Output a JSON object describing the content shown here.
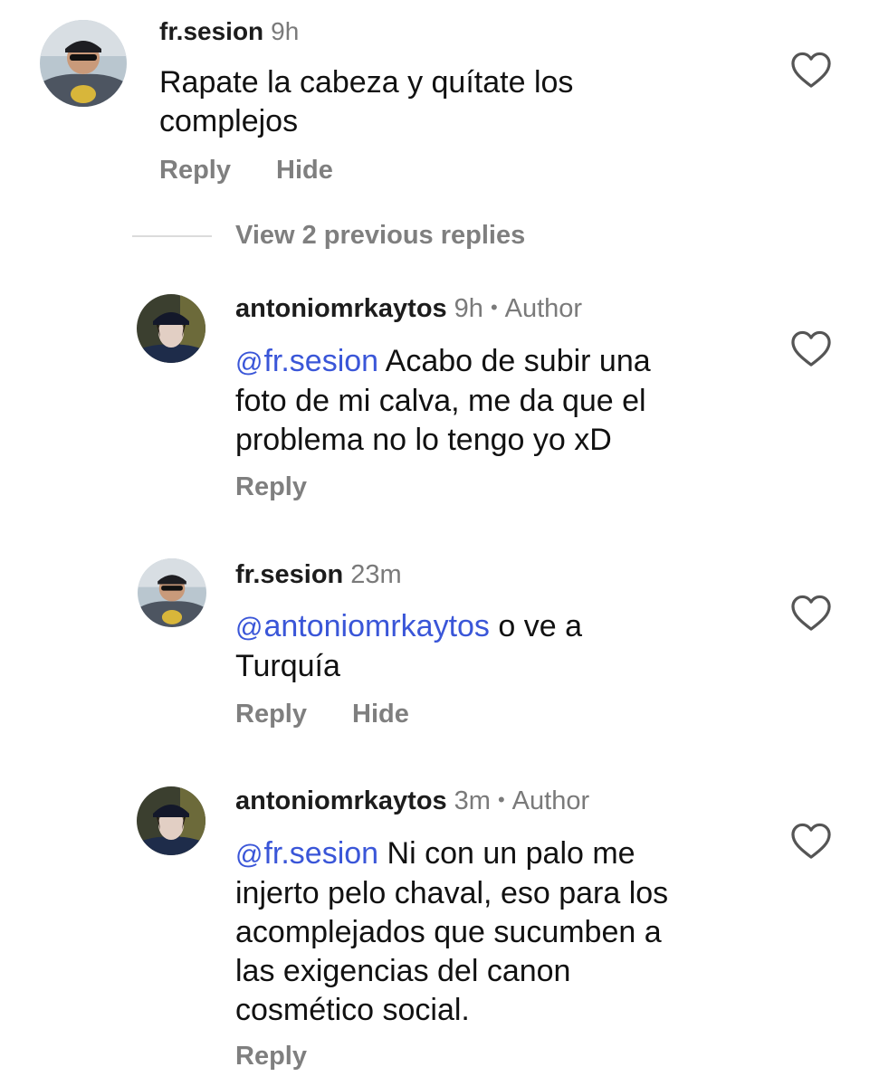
{
  "comments": [
    {
      "username": "fr.sesion",
      "time": "9h",
      "author_label": "",
      "mention": "",
      "text_lines": [
        "Rapate la cabeza y quítate los",
        "complejos"
      ],
      "actions": [
        "Reply",
        "Hide"
      ]
    },
    {
      "username": "antoniomrkaytos",
      "time": "9h",
      "author_label": "Author",
      "mention": "fr.sesion",
      "text_lines": [
        " Acabo de subir una",
        "foto de mi calva, me da que el",
        "problema no lo tengo yo xD"
      ],
      "actions": [
        "Reply"
      ]
    },
    {
      "username": "fr.sesion",
      "time": "23m",
      "author_label": "",
      "mention": "antoniomrkaytos",
      "text_lines": [
        " o ve a",
        "Turquía"
      ],
      "actions": [
        "Reply",
        "Hide"
      ]
    },
    {
      "username": "antoniomrkaytos",
      "time": "3m",
      "author_label": "Author",
      "mention": "fr.sesion",
      "text_lines": [
        " Ni con un palo me",
        "injerto pelo chaval, eso para los",
        "acomplejados que sucumben a",
        "las exigencias del canon",
        "cosmético social."
      ],
      "actions": [
        "Reply"
      ]
    }
  ],
  "view_previous_replies": "View 2 previous replies",
  "dot_separator": "•",
  "icons": {
    "like": "heart-outline-icon",
    "mention": "threads-at-icon"
  },
  "colors": {
    "mention": "#3a56d8",
    "secondary_text": "#7a7a7a",
    "primary_text": "#111111"
  }
}
